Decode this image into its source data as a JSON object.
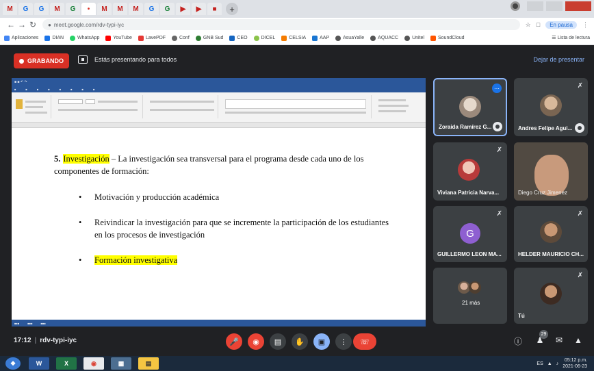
{
  "browser": {
    "tabs": [
      "M",
      "G",
      "G",
      "M",
      "G",
      "•",
      "M",
      "M",
      "M",
      "G",
      "G",
      "▶",
      "▶",
      "■"
    ],
    "url": "meet.google.com/rdv-typi-iyc",
    "pause_chip": "En pausa",
    "bookmarks": [
      "Aplicaciones",
      "DIAN",
      "WhatsApp",
      "YouTube",
      "LavePDF",
      "Conf",
      "GNB Sud",
      "CEO",
      "DICEL",
      "CELSIA",
      "AAP",
      "AsuaYalle",
      "AQUACC",
      "Unitel",
      "SoundCloud"
    ],
    "reading_list": "Lista de lectura"
  },
  "meet_top": {
    "recording_label": "GRABANDO",
    "presenting_text": "Estás presentando para todos",
    "stop_presenting": "Dejar de presentar"
  },
  "document": {
    "item_number": "5.",
    "item_highlight": "Investigación",
    "item_text": " – La investigación sea transversal para el programa desde cada uno de los componentes de formación:",
    "bullets": [
      "Motivación y producción académica",
      "Reivindicar la investigación para que se incremente la participación de los estudiantes en los procesos de investigación"
    ],
    "bullet_highlight": "Formación investigativa"
  },
  "participants": [
    {
      "name": "Zoraida Ramírez G..."
    },
    {
      "name": "Andres Felipe Agui..."
    },
    {
      "name": "Viviana Patricia Narva..."
    },
    {
      "name": "Diego Cruz Jimenez"
    },
    {
      "name": "GUILLERMO LEON MA...",
      "initial": "G"
    },
    {
      "name": "HELDER MAURICIO CH..."
    },
    {
      "name": "21 más"
    },
    {
      "name": "Tú"
    }
  ],
  "bottom_bar": {
    "time": "17:12",
    "meeting_code": "rdv-typi-iyc",
    "people_count": "29"
  },
  "taskbar": {
    "clock_time": "05:12 p.m.",
    "clock_date": "2021-06-23",
    "lang": "ES"
  },
  "colors": {
    "meet_bg": "#202124",
    "tile_bg": "#3c4043",
    "record_red": "#d93025",
    "highlight_yellow": "#ffff00",
    "word_blue": "#2b579a",
    "accent_blue": "#8ab4f8"
  }
}
